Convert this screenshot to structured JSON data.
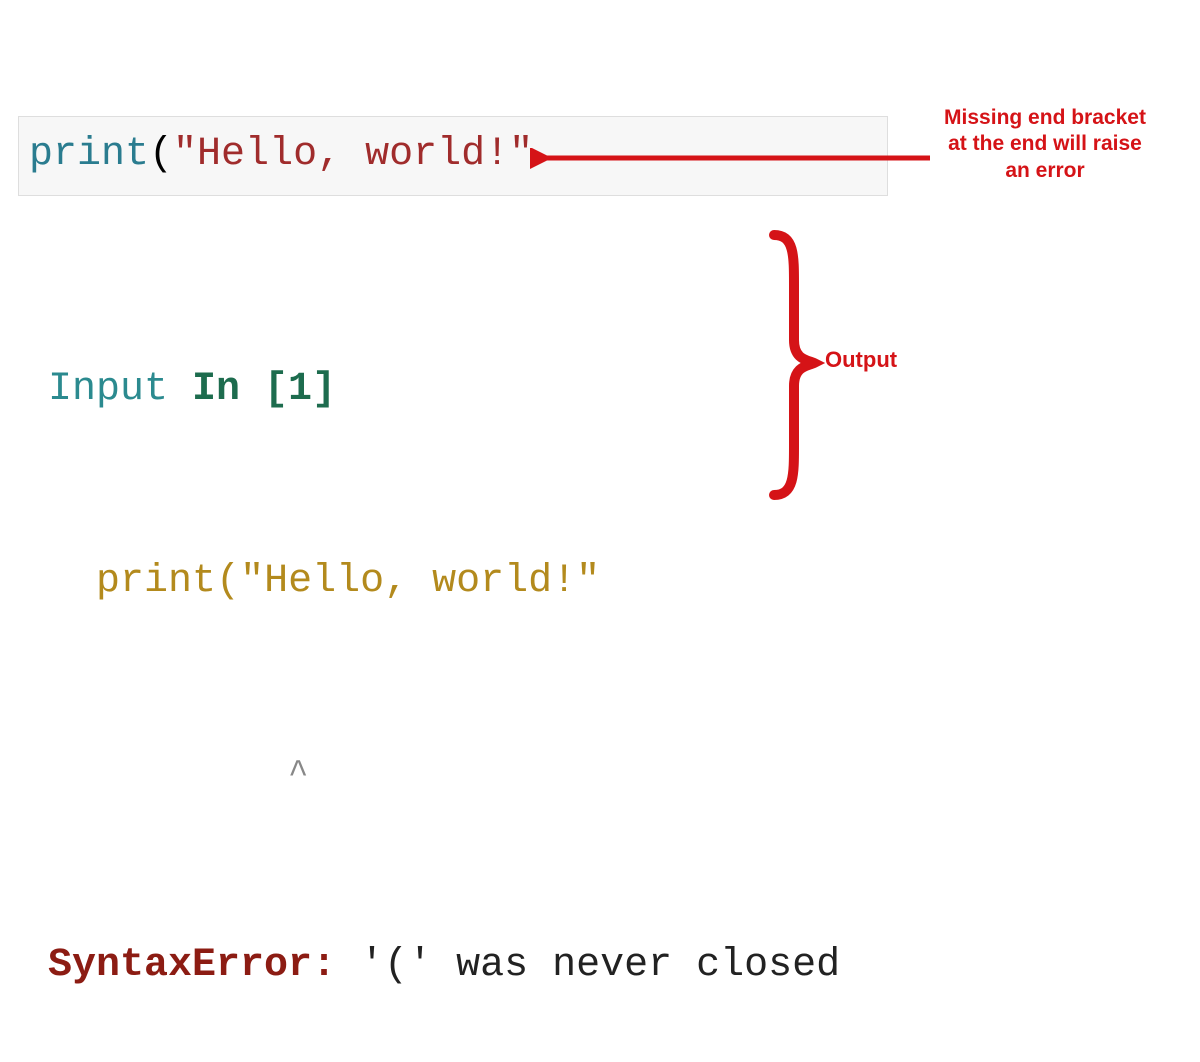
{
  "colors": {
    "annotation_red": "#d51317",
    "string_color": "#a02c2c",
    "func_color": "#2a7c8f",
    "error_name_color": "#8c1c13",
    "code_mustard": "#b38a1d",
    "input_teal": "#2b8a8f",
    "in_green": "#1d6c4e"
  },
  "code_cell": {
    "func": "print",
    "paren_open": "(",
    "string_literal": "\"Hello, world!\""
  },
  "annotations": {
    "missing_bracket": "Missing end bracket at the end will raise an error",
    "output_label": "Output"
  },
  "output": {
    "input_label": "Input ",
    "in_kw": "In ",
    "bracket_num": "[1]",
    "echoed_code_func": "print",
    "echoed_code_paren": "(",
    "echoed_code_str": "\"Hello, world!\"",
    "caret_indent": "          ",
    "caret": "^",
    "error_name": "SyntaxError:",
    "error_msg": " '(' was never closed"
  }
}
